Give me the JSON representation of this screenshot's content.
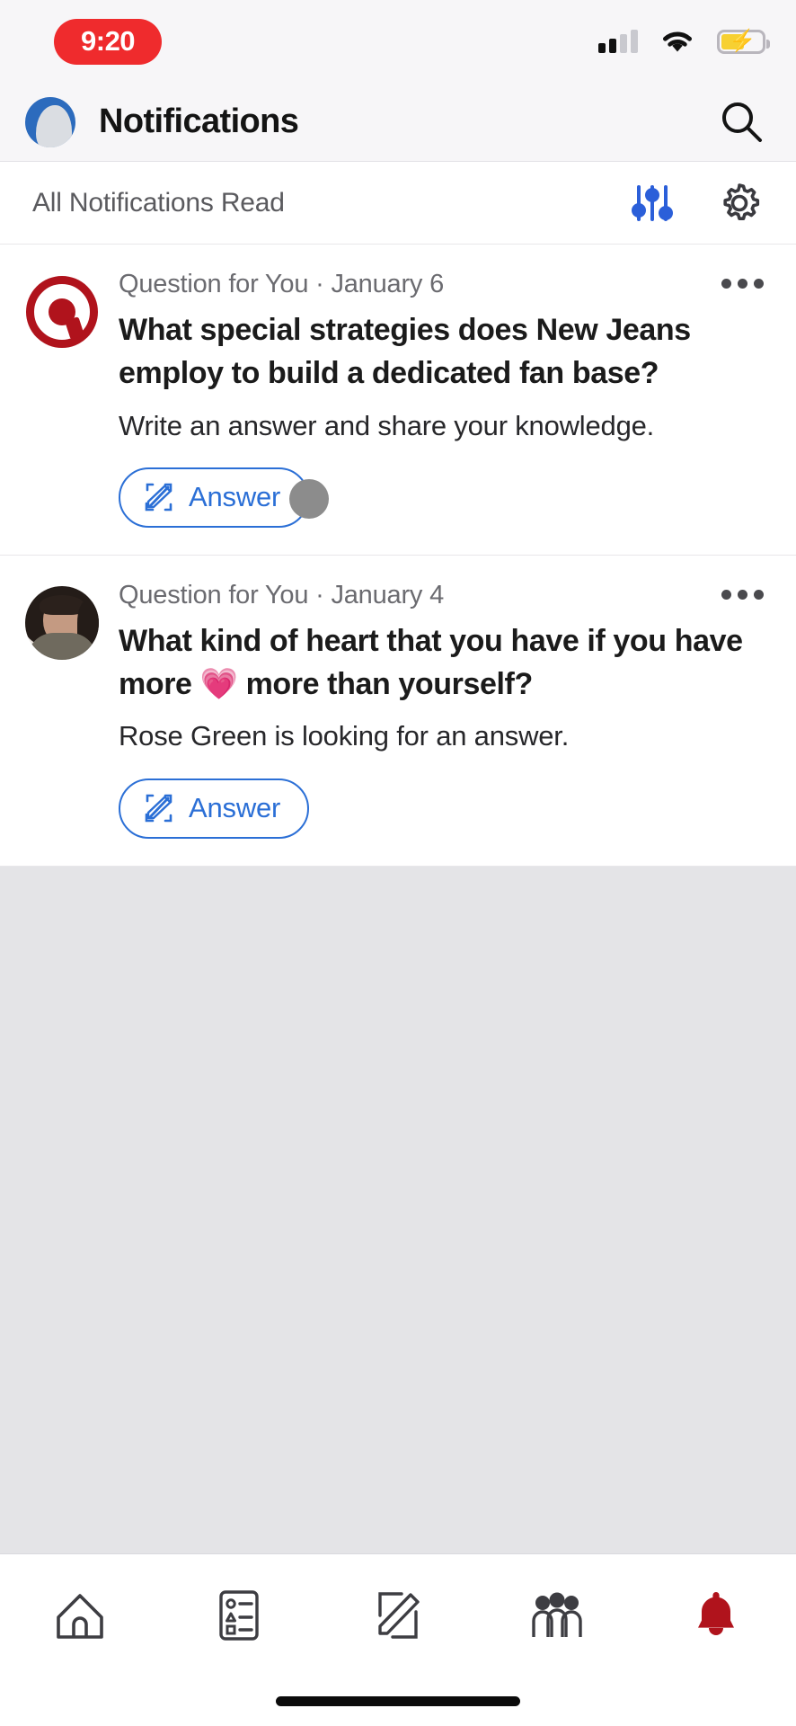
{
  "status_bar": {
    "time": "9:20",
    "signal_icon": "cellular-signal-icon",
    "wifi_icon": "wifi-icon",
    "battery_icon": "battery-charging-icon",
    "clock_pill_color": "#ef2b2d",
    "battery_color": "#f7d032"
  },
  "header": {
    "title": "Notifications",
    "avatar_icon": "profile-avatar-icon",
    "search_icon": "search-icon"
  },
  "filter_bar": {
    "label": "All Notifications Read",
    "filter_icon": "sliders-filter-icon",
    "settings_icon": "gear-icon",
    "filter_icon_color": "#2b5fd9"
  },
  "notifications": [
    {
      "avatar_type": "quora-logo",
      "source": "Question for You",
      "separator": "·",
      "date": "January 6",
      "question": "What special strategies does New Jeans employ to build a dedicated fan base?",
      "subtitle": "Write an answer and share your knowledge.",
      "action_label": "Answer",
      "action_icon": "write-pencil-icon",
      "more_icon": "more-options-icon"
    },
    {
      "avatar_type": "user-photo",
      "source": "Question for You",
      "separator": "·",
      "date": "January 4",
      "question_part1": "What kind of heart that you have if you have more",
      "question_emoji": "💗",
      "question_part2": "more than yourself?",
      "subtitle": "Rose Green is looking for an answer.",
      "action_label": "Answer",
      "action_icon": "write-pencil-icon",
      "more_icon": "more-options-icon"
    }
  ],
  "bottom_nav": {
    "items": [
      {
        "icon": "home-icon",
        "active": false
      },
      {
        "icon": "feed-list-icon",
        "active": false
      },
      {
        "icon": "write-pencil-icon",
        "active": false
      },
      {
        "icon": "spaces-people-icon",
        "active": false
      },
      {
        "icon": "notifications-bell-icon",
        "active": true
      }
    ],
    "active_color": "#b0131c",
    "inactive_color": "#3d3d42"
  },
  "home_indicator": {
    "icon": "home-indicator-bar"
  }
}
